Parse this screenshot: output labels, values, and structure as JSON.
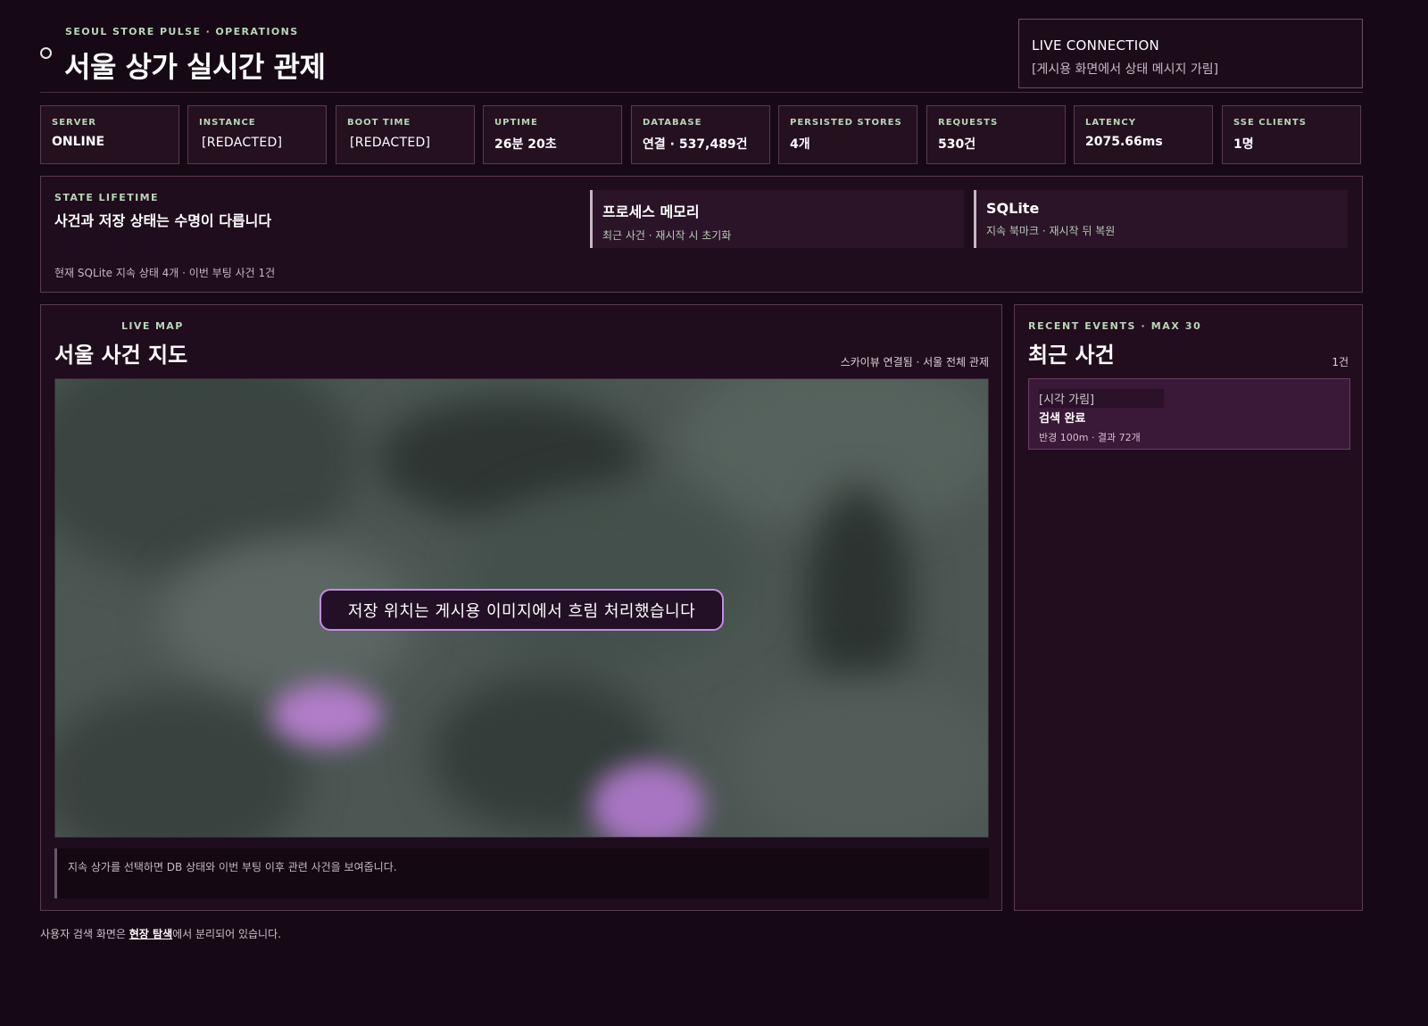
{
  "header": {
    "eyebrow": "SEOUL STORE PULSE · OPERATIONS",
    "title": "서울 상가 실시간 관제"
  },
  "live_connection": {
    "title": "LIVE CONNECTION",
    "status": "[게시용 화면에서 상태 메시지 가림]"
  },
  "stats": [
    {
      "label": "SERVER",
      "value": "ONLINE"
    },
    {
      "label": "INSTANCE",
      "value": "[REDACTED]"
    },
    {
      "label": "BOOT TIME",
      "value": "[REDACTED]"
    },
    {
      "label": "UPTIME",
      "value": "26분 20초"
    },
    {
      "label": "DATABASE",
      "value": "연결 · 537,489건"
    },
    {
      "label": "PERSISTED STORES",
      "value": "4개"
    },
    {
      "label": "REQUESTS",
      "value": "530건"
    },
    {
      "label": "LATENCY",
      "value": "2075.66ms"
    },
    {
      "label": "SSE CLIENTS",
      "value": "1명"
    }
  ],
  "lifetime": {
    "eyebrow": "STATE LIFETIME",
    "title": "사건과 저장 상태는 수명이 다릅니다",
    "note": "현재 SQLite 지속 상태 4개 · 이번 부팅 사건 1건",
    "cards": [
      {
        "title": "프로세스 메모리",
        "subtitle": "최근 사건 · 재시작 시 초기화"
      },
      {
        "title": "SQLite",
        "subtitle": "지속 북마크 · 재시작 뒤 복원"
      }
    ]
  },
  "map": {
    "eyebrow": "LIVE MAP",
    "title": "서울 사건 지도",
    "meta": "스카이뷰 연결됨 · 서울 전체 관제",
    "banner": "저장 위치는 게시용 이미지에서 흐림 처리했습니다",
    "hint": "지속 상가를 선택하면 DB 상태와 이번 부팅 이후 관련 사건을 보여줍니다."
  },
  "events": {
    "eyebrow": "RECENT EVENTS · MAX 30",
    "title": "최근 사건",
    "count": "1건",
    "items": [
      {
        "time": "[시각 가림]",
        "name": "검색 완료",
        "detail": "반경 100m · 결과 72개"
      }
    ]
  },
  "footer": {
    "prefix": "사용자 검색 화면은 ",
    "link": "현장 탐색",
    "suffix": "에서 분리되어 있습니다."
  },
  "colors": {
    "background": "#160915",
    "accent": "#c58ae6",
    "label_green": "#b7d6b7"
  }
}
